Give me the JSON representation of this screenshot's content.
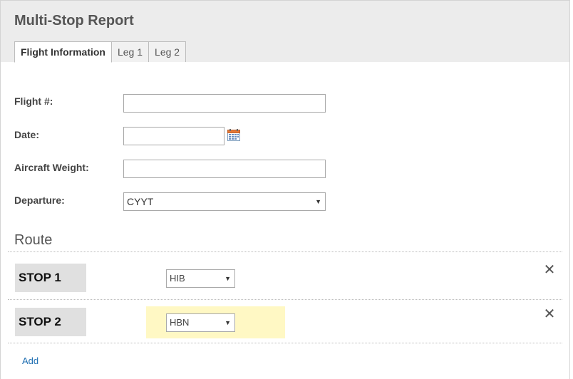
{
  "header": {
    "title": "Multi-Stop Report"
  },
  "tabs": [
    {
      "label": "Flight Information",
      "active": true
    },
    {
      "label": "Leg 1",
      "active": false
    },
    {
      "label": "Leg 2",
      "active": false
    }
  ],
  "form": {
    "flight_label": "Flight #:",
    "flight_value": "",
    "date_label": "Date:",
    "date_value": "",
    "date_icon": "calendar-icon",
    "weight_label": "Aircraft Weight:",
    "weight_value": "",
    "departure_label": "Departure:",
    "departure_value": "CYYT"
  },
  "route": {
    "title": "Route",
    "stops": [
      {
        "label": "STOP 1",
        "value": "HIB",
        "highlighted": false
      },
      {
        "label": "STOP 2",
        "value": "HBN",
        "highlighted": true
      }
    ],
    "remove_glyph": "✕",
    "add_label": "Add"
  },
  "colors": {
    "highlight": "#fff8c4",
    "link": "#1f6fb2",
    "header_bg": "#ececec"
  }
}
